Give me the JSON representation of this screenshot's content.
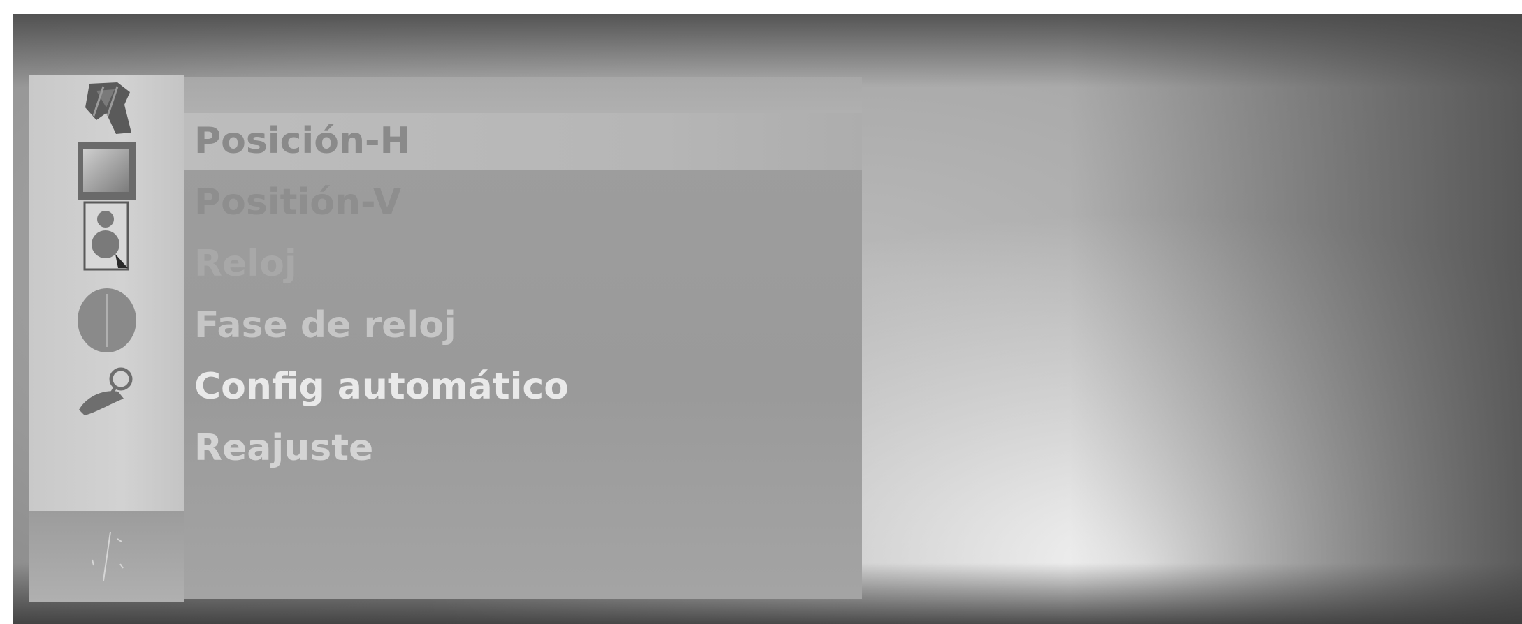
{
  "menu": {
    "items": [
      {
        "label": "Posición-H",
        "selected": true
      },
      {
        "label": "Positión-V",
        "selected": false
      },
      {
        "label": "Reloj",
        "selected": false
      },
      {
        "label": "Fase de reloj",
        "selected": false
      },
      {
        "label": "Config automático",
        "selected": false
      },
      {
        "label": "Reajuste",
        "selected": false
      }
    ]
  },
  "sidebar": {
    "icons": [
      {
        "name": "satellite-dish-icon"
      },
      {
        "name": "picture-icon"
      },
      {
        "name": "speaker-icon"
      },
      {
        "name": "clock-icon"
      },
      {
        "name": "key-icon"
      },
      {
        "name": "screen-adjust-icon"
      }
    ]
  },
  "colors": {
    "panel": "#9e9e9e",
    "highlight": "#bdbdbd",
    "icon_bar": "#c9c9c9",
    "text_selected": "#8a8a8a",
    "text_active": "#e9e9e9"
  }
}
